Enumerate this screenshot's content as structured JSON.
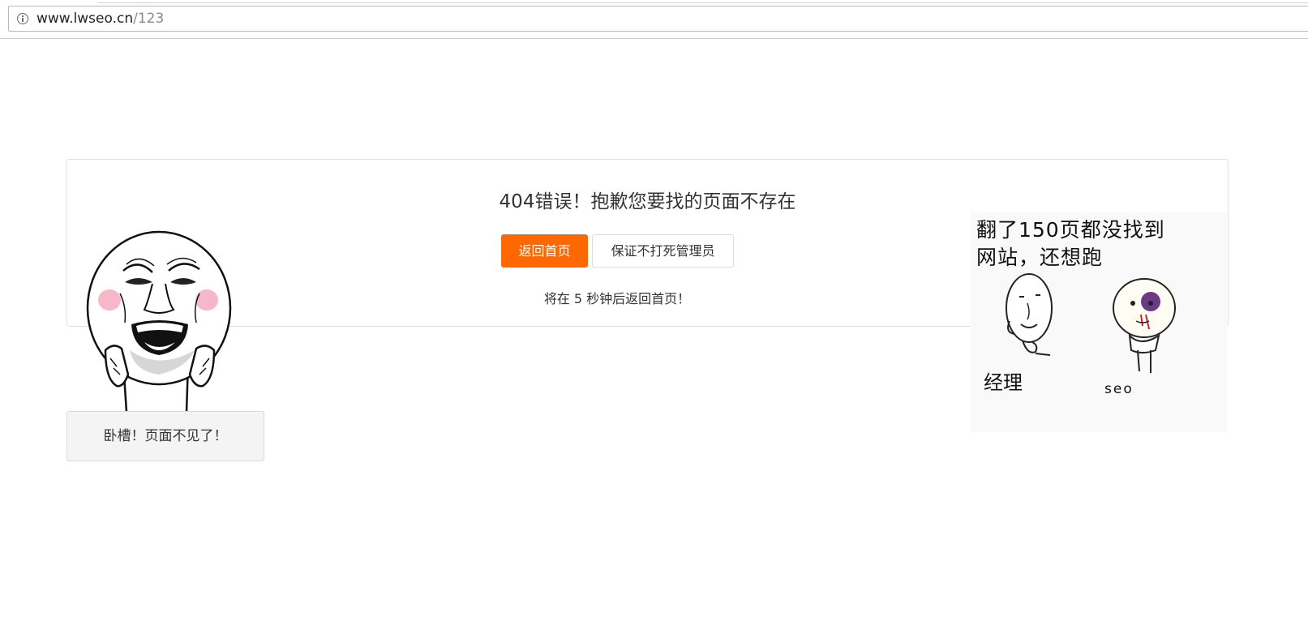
{
  "browser": {
    "url_host": "www.lwseo.cn",
    "url_path": "/123",
    "site_info_icon": "info-icon"
  },
  "error": {
    "title": "404错误！抱歉您要找的页面不存在",
    "home_button": "返回首页",
    "promise_button": "保证不打死管理员",
    "countdown": "将在 5 秒钟后返回首页！"
  },
  "left_meme": {
    "image": "laughing-face-meme",
    "caption": "卧槽！页面不见了！"
  },
  "right_meme": {
    "image": "manager-and-seo-meme",
    "line1": "翻了150页都没找到",
    "line2": "网站，还想跑",
    "label_manager": "经理",
    "label_seo": "seo"
  },
  "colors": {
    "accent": "#ff6700",
    "border": "#e2e2e2",
    "caption_bg": "#f4f4f4"
  }
}
